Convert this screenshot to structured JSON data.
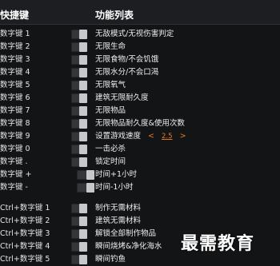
{
  "header": {
    "hotkey_col": "快捷键",
    "function_col": "功能列表"
  },
  "rows": [
    {
      "key": "数字键 1",
      "label": "无敌模式/无视伤害判定"
    },
    {
      "key": "数字键 2",
      "label": "无限生命"
    },
    {
      "key": "数字键 3",
      "label": "无限食物/不会饥饿"
    },
    {
      "key": "数字键 4",
      "label": "无限水分/不会口渴"
    },
    {
      "key": "数字键 5",
      "label": "无限氧气"
    },
    {
      "key": "数字键 6",
      "label": "建筑无限耐久度"
    },
    {
      "key": "数字键 7",
      "label": "无限物品"
    },
    {
      "key": "数字键 8",
      "label": "无限物品耐久度&使用次数"
    },
    {
      "key": "数字键 9",
      "label": "设置游戏速度"
    },
    {
      "key": "数字键 0",
      "label": "一击必杀"
    },
    {
      "key": "数字键 .",
      "label": "锁定时间"
    },
    {
      "key": "数字键 +",
      "label": "时间+1小时"
    },
    {
      "key": "数字键 -",
      "label": "时间-1小时"
    }
  ],
  "speed": {
    "left": "<",
    "value": "2.5",
    "right": ">"
  },
  "ctrl_rows": [
    {
      "key": "Ctrl+数字键 1",
      "label": "制作无需材料"
    },
    {
      "key": "Ctrl+数字键 2",
      "label": "建筑无需材料"
    },
    {
      "key": "Ctrl+数字键 3",
      "label": "解锁全部制作物品"
    },
    {
      "key": "Ctrl+数字键 4",
      "label": "瞬间烧烤&净化海水"
    },
    {
      "key": "Ctrl+数字键 5",
      "label": "瞬间钓鱼"
    }
  ],
  "watermark": "最需教育",
  "colors": {
    "background": "#131416",
    "accent": "#e07a1f",
    "toggle_knob": "#c6c8cb"
  }
}
